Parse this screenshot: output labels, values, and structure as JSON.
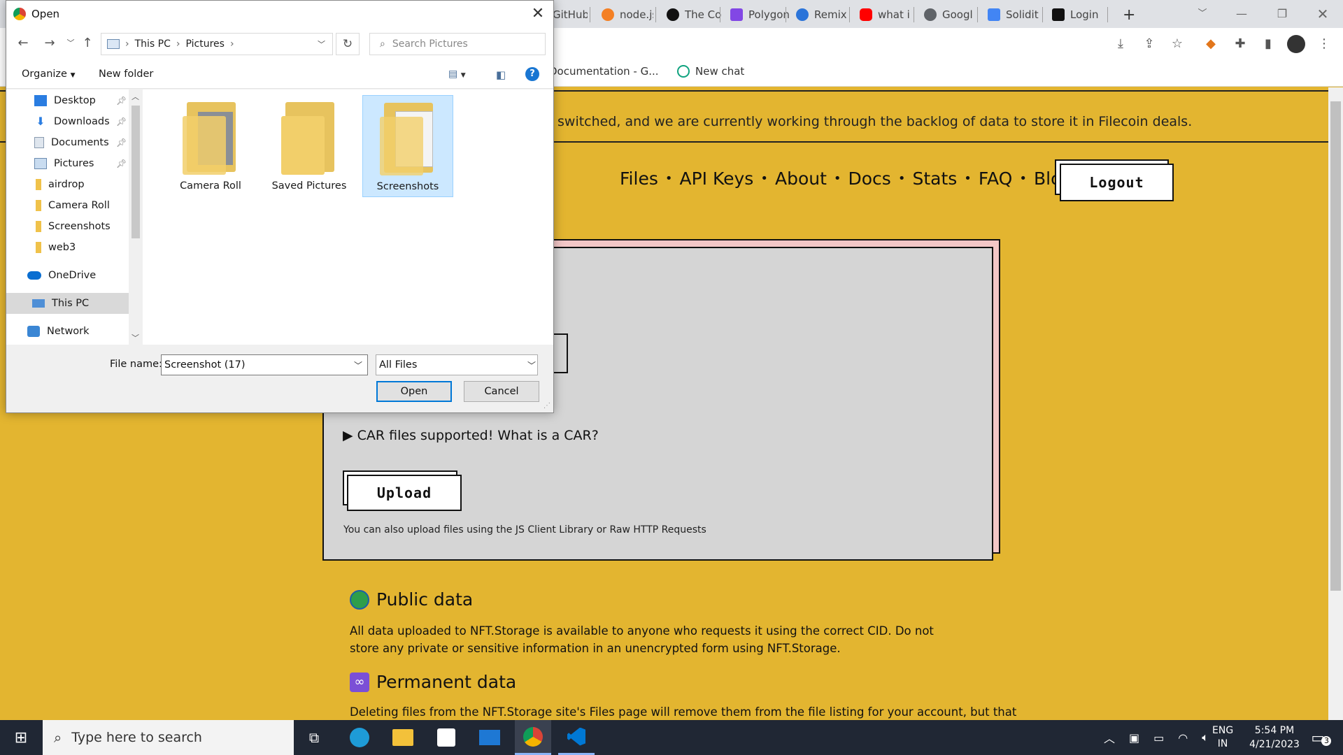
{
  "browser": {
    "tabs": [
      {
        "label": "GitHub",
        "color": "#333333"
      },
      {
        "label": "node.js",
        "color": "#f48024"
      },
      {
        "label": "The Co",
        "color": "#111111"
      },
      {
        "label": "Polygon",
        "color": "#8247e5"
      },
      {
        "label": "Remix",
        "color": "#2b74d9"
      },
      {
        "label": "what i",
        "color": "#ff0000"
      },
      {
        "label": "Googl",
        "color": "#5f6368"
      },
      {
        "label": "Solidit",
        "color": "#4285f4"
      },
      {
        "label": "Login",
        "color": "#111111"
      }
    ],
    "new_tab": "+",
    "bookmarks": [
      {
        "label": "Documentation - G..."
      },
      {
        "label": "New chat"
      }
    ]
  },
  "page": {
    "banner_text": "switched, and we are currently working through the backlog of data to store it in Filecoin deals.",
    "nav": [
      "Files",
      "API Keys",
      "About",
      "Docs",
      "Stats",
      "FAQ",
      "Blog"
    ],
    "nav_separator": "•",
    "logout_label": "Logout",
    "car_text": "▶ CAR files supported! What is a CAR?",
    "upload_label": "Upload",
    "also_text": "You can also upload files using the JS Client Library or Raw HTTP Requests",
    "public_heading": "Public data",
    "public_text": "All data uploaded to NFT.Storage is available to anyone who requests it using the correct CID. Do not store any private or sensitive information in an unencrypted form using NFT.Storage.",
    "permanent_heading": "Permanent data",
    "permanent_text": "Deleting files from the NFT.Storage site's Files page will remove them from the file listing for your account, but that"
  },
  "dialog": {
    "title": "Open",
    "breadcrumb": [
      "This PC",
      "Pictures"
    ],
    "search_placeholder": "Search Pictures",
    "organize": "Organize",
    "new_folder": "New folder",
    "nav_items": [
      {
        "label": "Desktop",
        "icon": "desktop-icon",
        "pinned": true
      },
      {
        "label": "Downloads",
        "icon": "downloads-icon",
        "pinned": true
      },
      {
        "label": "Documents",
        "icon": "documents-icon",
        "pinned": true
      },
      {
        "label": "Pictures",
        "icon": "pictures-icon",
        "pinned": true
      },
      {
        "label": "airdrop",
        "icon": "folder-icon",
        "pinned": false
      },
      {
        "label": "Camera Roll",
        "icon": "folder-icon",
        "pinned": false
      },
      {
        "label": "Screenshots",
        "icon": "folder-icon",
        "pinned": false
      },
      {
        "label": "web3",
        "icon": "folder-icon",
        "pinned": false
      },
      {
        "label": "OneDrive",
        "icon": "onedrive-icon",
        "pinned": false
      },
      {
        "label": "This PC",
        "icon": "this-pc-icon",
        "pinned": false
      },
      {
        "label": "Network",
        "icon": "network-icon",
        "pinned": false
      }
    ],
    "folders": [
      {
        "label": "Camera Roll"
      },
      {
        "label": "Saved Pictures"
      },
      {
        "label": "Screenshots"
      }
    ],
    "file_name_label": "File name:",
    "file_name_value": "Screenshot (17)",
    "file_type": "All Files",
    "open_label": "Open",
    "cancel_label": "Cancel"
  },
  "taskbar": {
    "search_placeholder": "Type here to search",
    "lang_1": "ENG",
    "lang_2": "IN",
    "time": "5:54 PM",
    "date": "4/21/2023",
    "notif_count": "3"
  }
}
